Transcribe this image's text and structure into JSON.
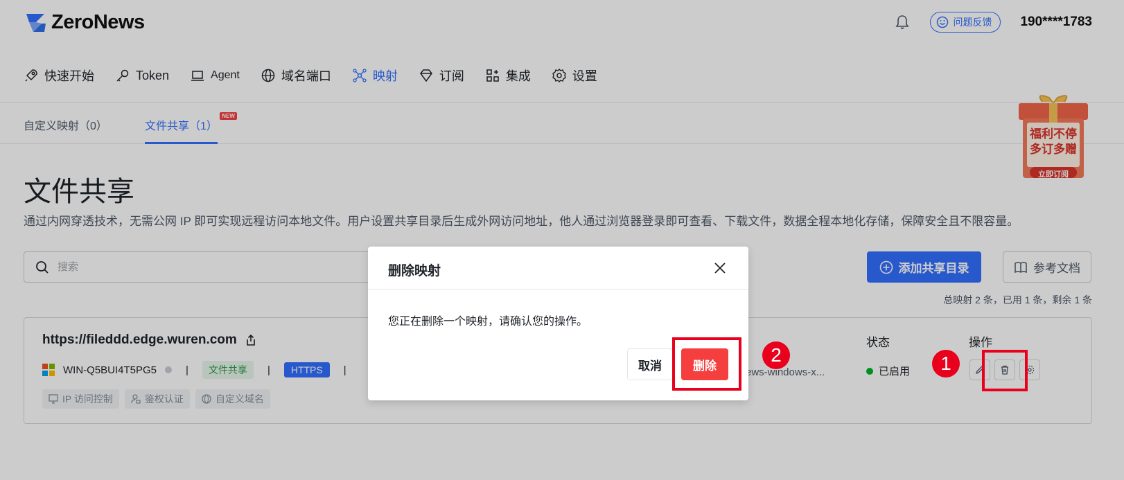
{
  "app": {
    "logo_text": "ZeroNews",
    "feedback_label": "问题反馈",
    "user_phone": "190****1783"
  },
  "nav": {
    "items": [
      {
        "label": "快速开始",
        "icon": "rocket-icon"
      },
      {
        "label": "Token",
        "icon": "key-icon"
      },
      {
        "label": "Agent",
        "icon": "laptop-icon"
      },
      {
        "label": "域名端口",
        "icon": "globe-icon"
      },
      {
        "label": "映射",
        "icon": "network-icon",
        "active": true
      },
      {
        "label": "订阅",
        "icon": "diamond-icon"
      },
      {
        "label": "集成",
        "icon": "apps-icon"
      },
      {
        "label": "设置",
        "icon": "gear-icon"
      }
    ]
  },
  "subtabs": {
    "custom": "自定义映射（0）",
    "file_share": "文件共享（1）",
    "new_badge": "NEW"
  },
  "promo": {
    "line1": "福利不停",
    "line2": "多订多赠",
    "cta": "立即订阅"
  },
  "page": {
    "title": "文件共享",
    "description": "通过内网穿透技术，无需公网 IP 即可实现远程访问本地文件。用户设置共享目录后生成外网访问地址，他人通过浏览器登录即可查看、下载文件，数据全程本地化存储，保障安全且不限容量。"
  },
  "toolbar": {
    "search_placeholder": "搜索",
    "add_label": "添加共享目录",
    "doc_label": "参考文档",
    "summary": "总映射 2 条，已用 1 条，剩余 1 条"
  },
  "card": {
    "url": "https://fileddd.edge.wuren.com",
    "device": "WIN-Q5BUI4T5PG5",
    "type_tag": "文件共享",
    "protocol_tag": "HTTPS",
    "agent_text": "ews-windows-x...",
    "features": [
      "IP 访问控制",
      "鉴权认证",
      "自定义域名"
    ],
    "status_header": "状态",
    "status_value": "已启用",
    "ops_header": "操作"
  },
  "modal": {
    "title": "删除映射",
    "body": "您正在删除一个映射，请确认您的操作。",
    "cancel": "取消",
    "confirm": "删除"
  },
  "annotations": {
    "step1": "1",
    "step2": "2",
    "highlight_color": "#e8001c"
  },
  "colors": {
    "primary": "#3370ff",
    "danger": "#f53f3f",
    "success": "#00b42a"
  }
}
